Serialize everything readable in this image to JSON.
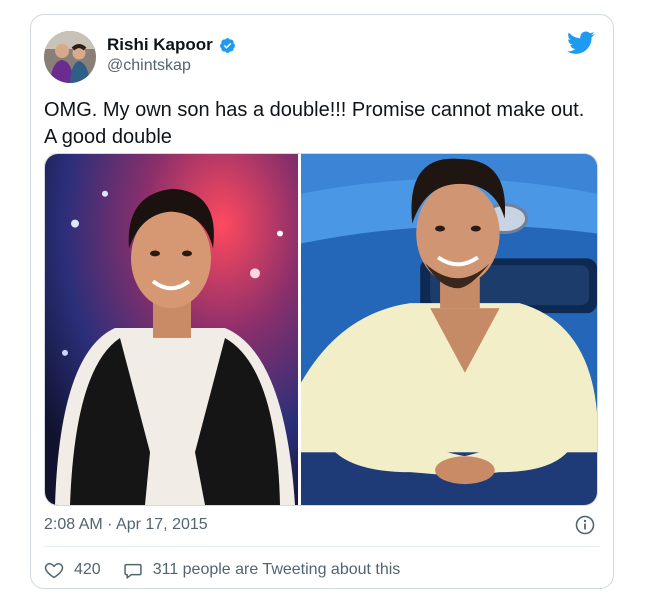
{
  "tweet": {
    "author_name": "Rishi Kapoor",
    "author_handle": "@chintskap",
    "verified": true,
    "text_line1": "OMG. My own son has a double!!! Promise cannot make out.",
    "text_line2": "A good double",
    "timestamp": "2:08 AM · Apr 17, 2015",
    "likes": "420",
    "tweeting_about": "311 people are Tweeting about this"
  },
  "media": {
    "left_photo": "man-in-white-shirt-and-black-vest-on-stage",
    "right_photo": "man-in-cream-shirt-sitting-in-front-of-blue-car"
  },
  "colors": {
    "twitter_blue": "#1d9bf0",
    "secondary_text": "#536471",
    "border": "#cfd9de"
  },
  "icons": {
    "verified": "verified-badge-icon",
    "brand": "twitter-bird-icon",
    "info": "info-icon",
    "like": "heart-icon",
    "reply": "speech-bubble-icon"
  }
}
